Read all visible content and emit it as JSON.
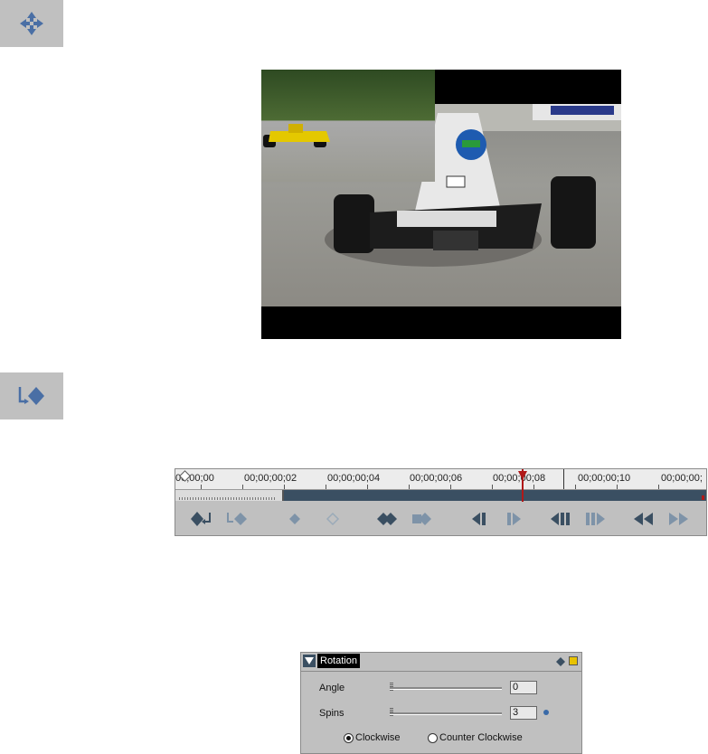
{
  "icons": {
    "move": "move-arrows-icon",
    "keyframe": "add-keyframe-icon"
  },
  "timeline": {
    "timecodes": [
      "00;00;00",
      "00;00;00;02",
      "00;00;00;04",
      "00;00;00;06",
      "00;00;00;08",
      "00;00;00;10",
      "00;00;00;"
    ]
  },
  "rotation": {
    "title": "Rotation",
    "angle_label": "Angle",
    "angle_value": "0",
    "spins_label": "Spins",
    "spins_value": "3",
    "clockwise_label": "Clockwise",
    "counter_clockwise_label": "Counter Clockwise",
    "direction_selected": "clockwise"
  },
  "colors": {
    "accent": "#3a4f62",
    "icon_blue": "#4a6fa5",
    "panel_gray": "#c0c0c0",
    "playhead_red": "#b01818",
    "keyframe_gold": "#e8c200"
  }
}
